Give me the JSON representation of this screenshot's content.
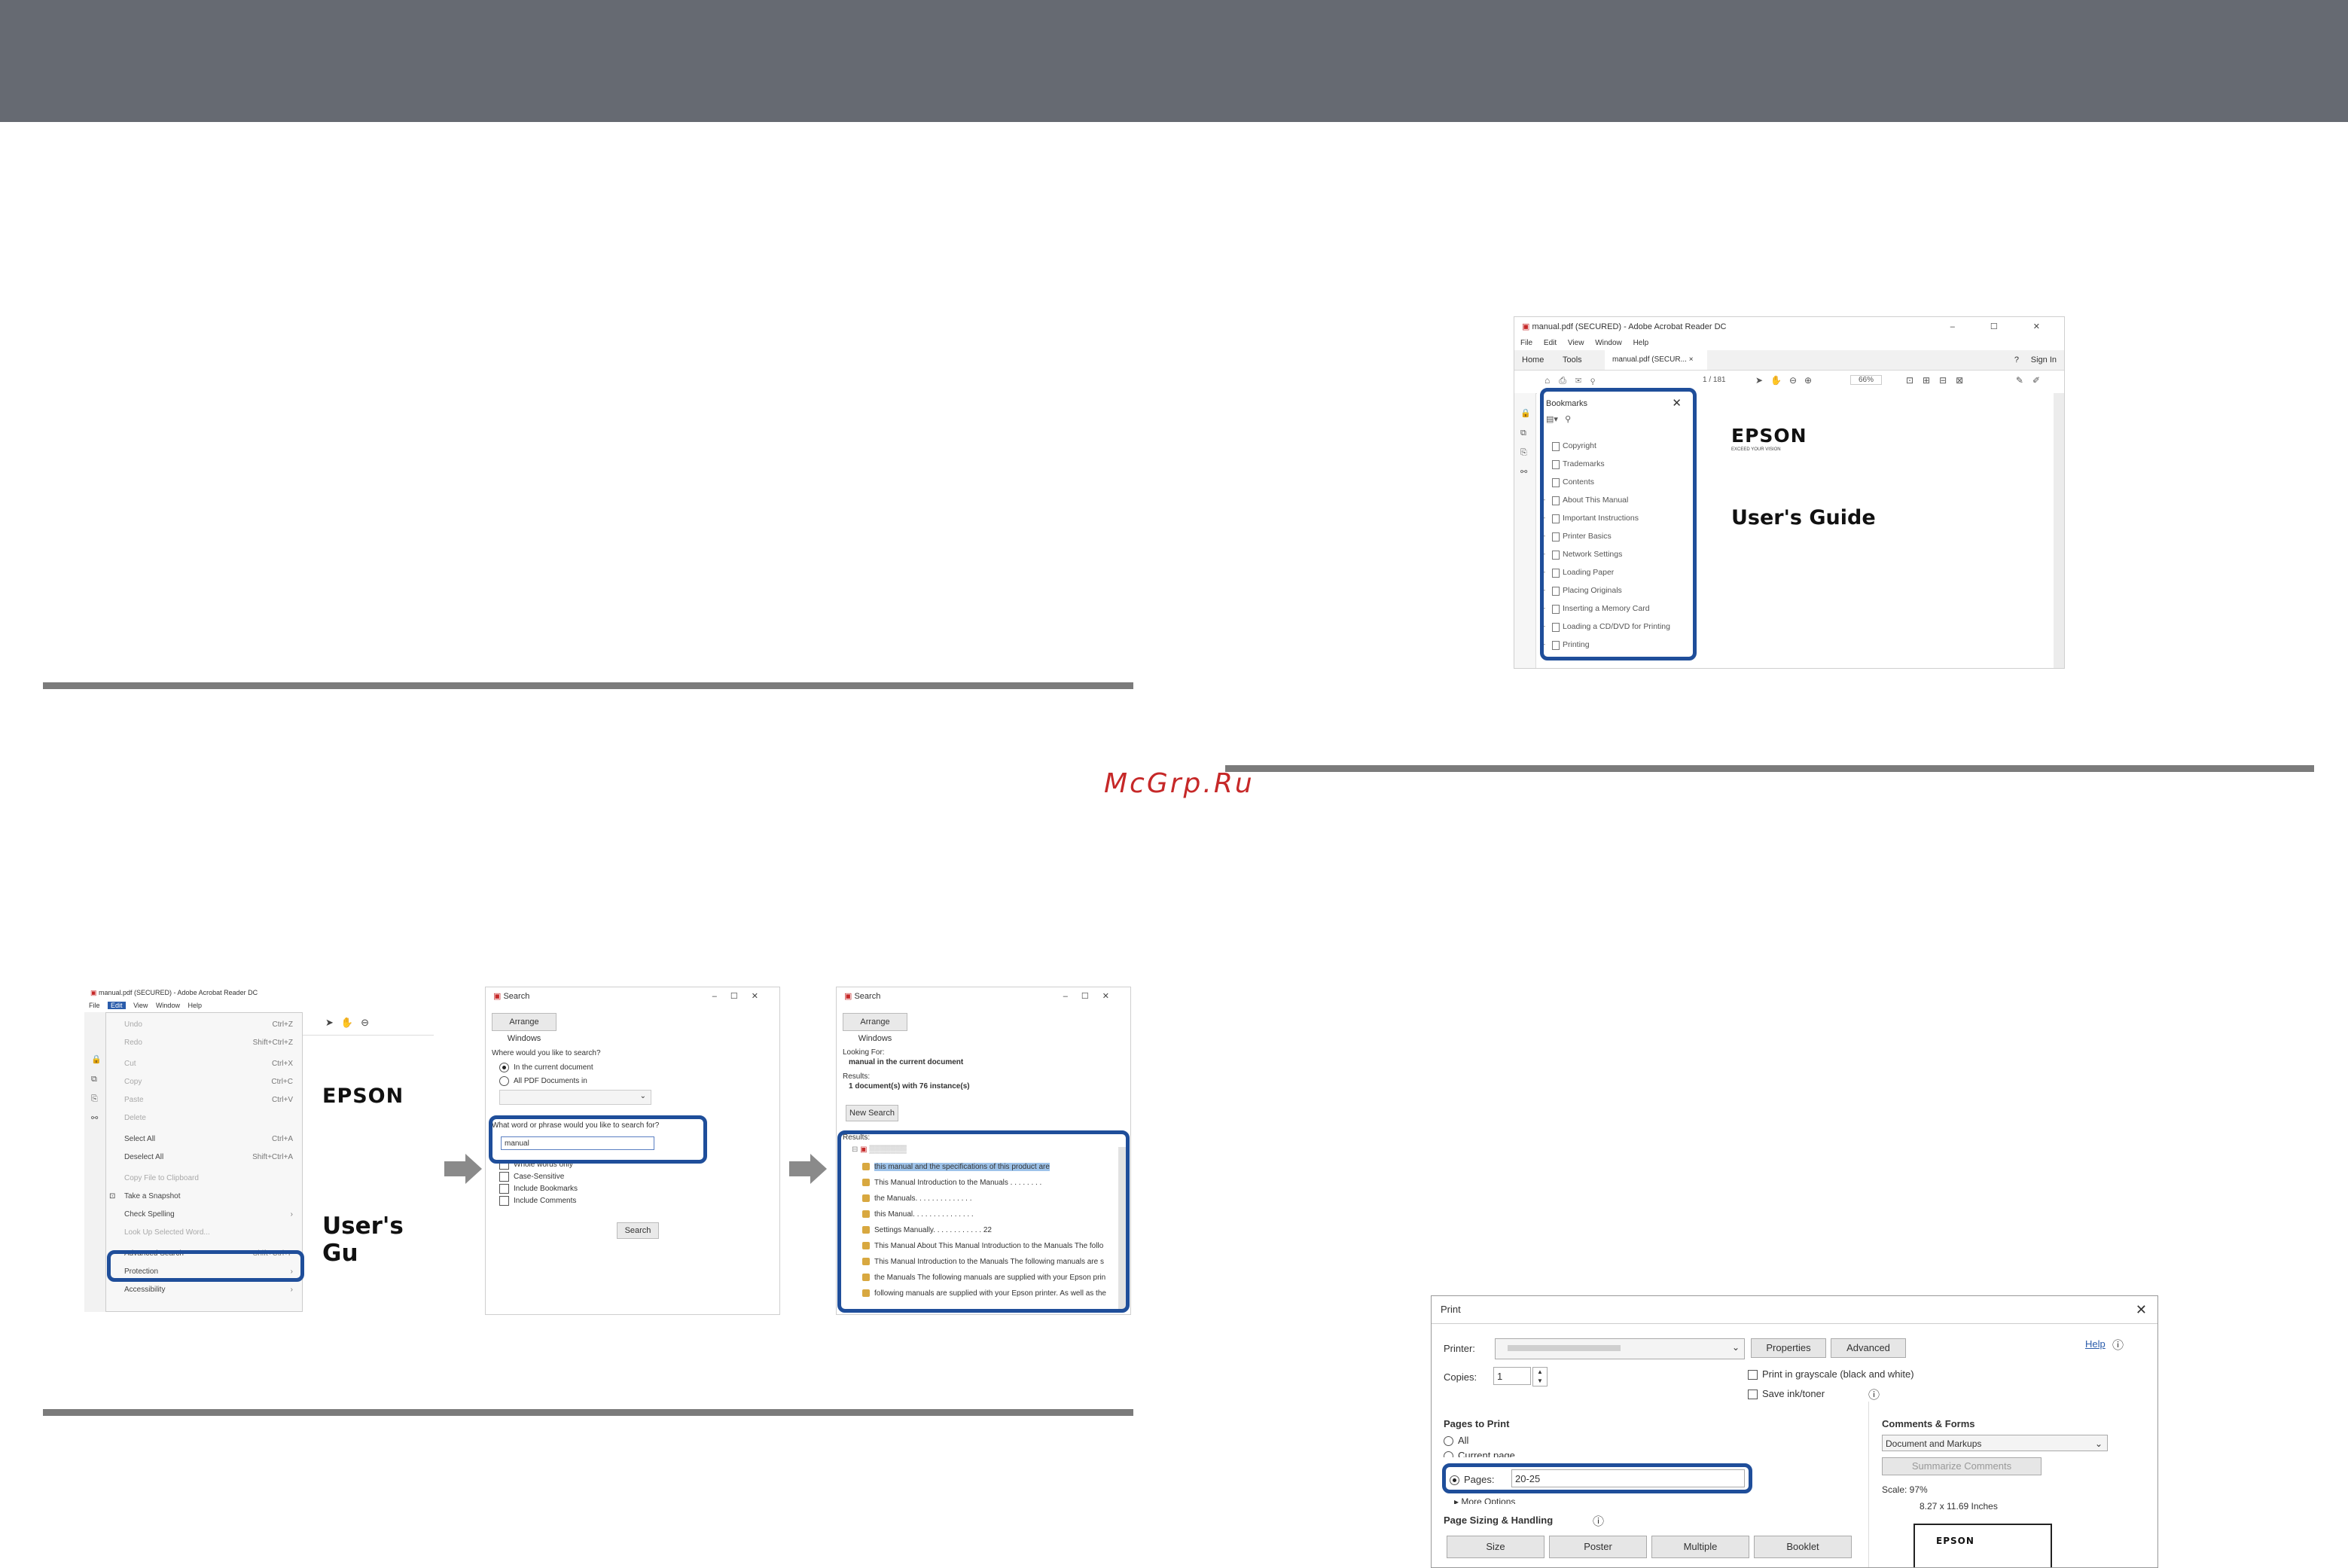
{
  "watermark": "McGrp.Ru",
  "reader": {
    "title": "manual.pdf (SECURED) - Adobe Acrobat Reader DC",
    "window_controls": "– ☐ ✕",
    "menus": [
      "File",
      "Edit",
      "View",
      "Window",
      "Help"
    ],
    "tab_home": "Home",
    "tab_tools": "Tools",
    "tab_doc": "manual.pdf (SECUR...",
    "tab_close": "×",
    "help": "?",
    "sign_in": "Sign In",
    "page_num": "1",
    "page_total": "/ 181",
    "zoom": "66%",
    "bookmarks_title": "Bookmarks",
    "bookmarks": [
      {
        "label": "Copyright",
        "expandable": false
      },
      {
        "label": "Trademarks",
        "expandable": false
      },
      {
        "label": "Contents",
        "expandable": false
      },
      {
        "label": "About This Manual",
        "expandable": true
      },
      {
        "label": "Important Instructions",
        "expandable": true
      },
      {
        "label": "Printer Basics",
        "expandable": true
      },
      {
        "label": "Network Settings",
        "expandable": true
      },
      {
        "label": "Loading Paper",
        "expandable": true
      },
      {
        "label": "Placing Originals",
        "expandable": true
      },
      {
        "label": "Inserting a Memory Card",
        "expandable": true
      },
      {
        "label": "Loading a CD/DVD for Printing",
        "expandable": true
      },
      {
        "label": "Printing",
        "expandable": true
      }
    ],
    "brand": "EPSON",
    "brand_tagline": "EXCEED YOUR VISION",
    "doc_title": "User's Guide"
  },
  "edit_menu": {
    "title": "manual.pdf (SECURED) - Adobe Acrobat Reader DC",
    "menus": [
      "File",
      "Edit",
      "View",
      "Window",
      "Help"
    ],
    "items": [
      {
        "label": "Undo",
        "shortcut": "Ctrl+Z",
        "dim": true
      },
      {
        "label": "Redo",
        "shortcut": "Shift+Ctrl+Z",
        "dim": true
      },
      {
        "label": "Cut",
        "shortcut": "Ctrl+X",
        "dim": true
      },
      {
        "label": "Copy",
        "shortcut": "Ctrl+C",
        "dim": true
      },
      {
        "label": "Paste",
        "shortcut": "Ctrl+V",
        "dim": true
      },
      {
        "label": "Delete",
        "shortcut": "",
        "dim": true
      },
      {
        "label": "Select All",
        "shortcut": "Ctrl+A",
        "dim": false
      },
      {
        "label": "Deselect All",
        "shortcut": "Shift+Ctrl+A",
        "dim": false
      },
      {
        "label": "Copy File to Clipboard",
        "shortcut": "",
        "dim": true
      },
      {
        "label": "Take a Snapshot",
        "shortcut": "",
        "dim": false
      },
      {
        "label": "Check Spelling",
        "shortcut": "›",
        "dim": false
      },
      {
        "label": "Look Up Selected Word...",
        "shortcut": "",
        "dim": true
      },
      {
        "label": "Advanced Search",
        "shortcut": "Shift+Ctrl+F",
        "dim": false
      },
      {
        "label": "Protection",
        "shortcut": "›",
        "dim": false
      },
      {
        "label": "Accessibility",
        "shortcut": "›",
        "dim": false
      }
    ],
    "brand": "EPSON",
    "doc_title": "User's Gu"
  },
  "search1": {
    "title": "Search",
    "arrange": "Arrange Windows",
    "where_q": "Where would you like to search?",
    "opt_current": "In the current document",
    "opt_all": "All PDF Documents in",
    "what_q": "What word or phrase would you like to search for?",
    "query": "manual",
    "opts": [
      "Whole words only",
      "Case-Sensitive",
      "Include Bookmarks",
      "Include Comments"
    ],
    "search_btn": "Search"
  },
  "search2": {
    "title": "Search",
    "arrange": "Arrange Windows",
    "looking_for": "Looking For:",
    "looking_value": "manual in the current document",
    "results_label": "Results:",
    "results_value": "1 document(s) with 76 instance(s)",
    "new_search": "New Search",
    "results_header": "Results:",
    "results": [
      "this manual and the specifications of this product are",
      "This Manual Introduction to the Manuals . . . . . . . .",
      "the Manuals. . . . . . . . . . . . . .",
      "this Manual. . . . . . . . . . . . . . .",
      "Settings Manually. . . . . . . . . . . . 22",
      "This Manual About This Manual Introduction to the Manuals The follo",
      "This Manual Introduction to the Manuals The following manuals are s",
      "the Manuals The following manuals are supplied with your Epson prin",
      "following manuals are supplied with your Epson printer. As well as the"
    ]
  },
  "print": {
    "title": "Print",
    "printer_label": "Printer:",
    "properties": "Properties",
    "advanced": "Advanced",
    "help": "Help",
    "copies_label": "Copies:",
    "copies_value": "1",
    "grayscale": "Print in grayscale (black and white)",
    "save_ink": "Save ink/toner",
    "pages_section": "Pages to Print",
    "all": "All",
    "current_page": "Current page",
    "pages_label": "Pages",
    "pages_value": "20-25",
    "more_options": "More Options",
    "comments_section": "Comments & Forms",
    "comments_value": "Document and Markups",
    "summarize": "Summarize Comments",
    "scale": "Scale: 97%",
    "paper_size": "8.27 x 11.69 Inches",
    "sizing_section": "Page Sizing & Handling",
    "size_btn": "Size",
    "poster_btn": "Poster",
    "multiple_btn": "Multiple",
    "booklet_btn": "Booklet",
    "preview_brand": "EPSON"
  }
}
